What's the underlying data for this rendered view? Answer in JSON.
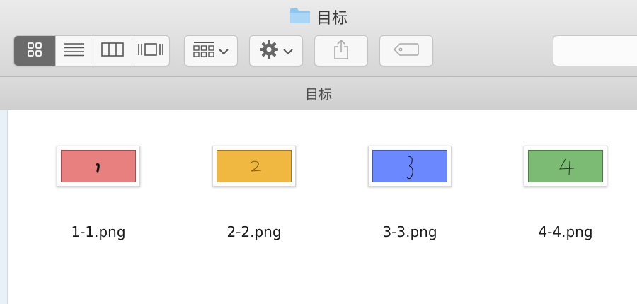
{
  "window": {
    "title": "目标",
    "folder_icon": "folder-icon"
  },
  "toolbar": {
    "view_modes": [
      {
        "name": "icon-view",
        "icon": "grid-icon",
        "active": true
      },
      {
        "name": "list-view",
        "icon": "list-icon",
        "active": false
      },
      {
        "name": "column-view",
        "icon": "columns-icon",
        "active": false
      },
      {
        "name": "gallery-view",
        "icon": "cover-flow-icon",
        "active": false
      }
    ],
    "arrange_icon": "arrange-icon",
    "action_icon": "gear-icon",
    "share_icon": "share-icon",
    "tags_icon": "tag-icon",
    "search": {
      "value": "",
      "placeholder": ""
    }
  },
  "pathbar": {
    "title": "目标"
  },
  "files": [
    {
      "name": "1-1.png",
      "thumb_color": "#e88080",
      "glyph": "1"
    },
    {
      "name": "2-2.png",
      "thumb_color": "#f0b840",
      "glyph": "2"
    },
    {
      "name": "3-3.png",
      "thumb_color": "#6b88ff",
      "glyph": "3"
    },
    {
      "name": "4-4.png",
      "thumb_color": "#7cbb74",
      "glyph": "4"
    }
  ]
}
